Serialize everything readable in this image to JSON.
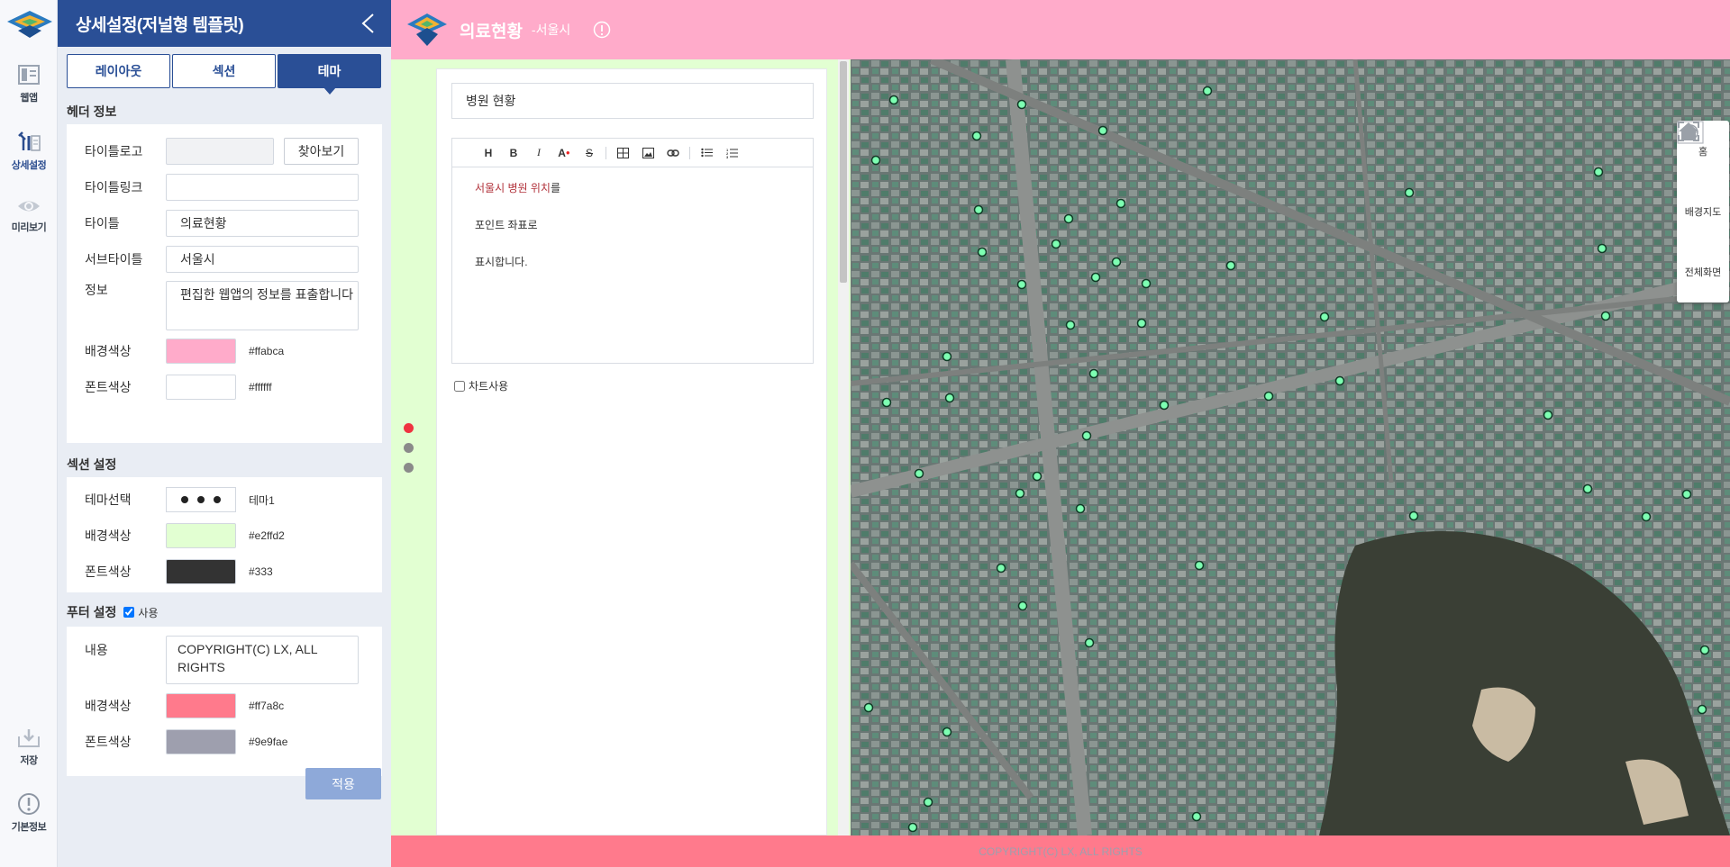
{
  "rail": {
    "items": [
      {
        "label": "웹앱",
        "icon": "webapp-icon"
      },
      {
        "label": "상세설정",
        "icon": "tools-icon"
      },
      {
        "label": "미리보기",
        "icon": "eye-icon"
      },
      {
        "label": "저장",
        "icon": "save-icon"
      },
      {
        "label": "기본정보",
        "icon": "info-icon"
      }
    ]
  },
  "panel": {
    "title": "상세설정(저널형 템플릿)",
    "tabs": [
      "레이아웃",
      "섹션",
      "테마"
    ],
    "active_tab": "테마",
    "header_section": {
      "title": "헤더 정보",
      "logo_label": "타이틀로고",
      "find_button": "찾아보기",
      "link_label": "타이틀링크",
      "title_label": "타이틀",
      "title_value": "의료현황",
      "subtitle_label": "서브타이틀",
      "subtitle_value": "서울시",
      "info_label": "정보",
      "info_value": "편집한 웹앱의 정보를 표출합니다",
      "bg_label": "배경색상",
      "bg_color": "#ffabca",
      "bg_hex": "#ffabca",
      "font_label": "폰트색상",
      "font_color": "#ffffff",
      "font_hex": "#ffffff"
    },
    "section_settings": {
      "title": "섹션 설정",
      "theme_label": "테마선택",
      "theme_value": "테마1",
      "bg_label": "배경색상",
      "bg_color": "#e2ffd2",
      "bg_hex": "#e2ffd2",
      "font_label": "폰트색상",
      "font_color": "#333333",
      "font_hex": "#333"
    },
    "footer_settings": {
      "title": "푸터 설정",
      "use_label": "사용",
      "content_label": "내용",
      "content_value": "COPYRIGHT(C) LX, ALL RIGHTS",
      "bg_label": "배경색상",
      "bg_color": "#ff7a8c",
      "bg_hex": "#ff7a8c",
      "font_label": "폰트색상",
      "font_color": "#9e9fae",
      "font_hex": "#9e9fae"
    },
    "apply_button": "적용"
  },
  "preview": {
    "header": {
      "title": "의료현황",
      "subtitle": "-서울시"
    },
    "card": {
      "title": "병원 현황",
      "body_red": "서울시 병원 위치",
      "body_rest": "를",
      "line2": "포인트 좌표로",
      "line3": "표시합니다.",
      "chart_checkbox": "차트사용"
    },
    "map_controls": [
      {
        "label": "홈",
        "icon": "home-icon"
      },
      {
        "label": "배경지도",
        "icon": "globe-icon"
      },
      {
        "label": "전체화면",
        "icon": "fullscreen-icon"
      }
    ],
    "footer_text": "COPYRIGHT(C) LX, ALL RIGHTS"
  }
}
